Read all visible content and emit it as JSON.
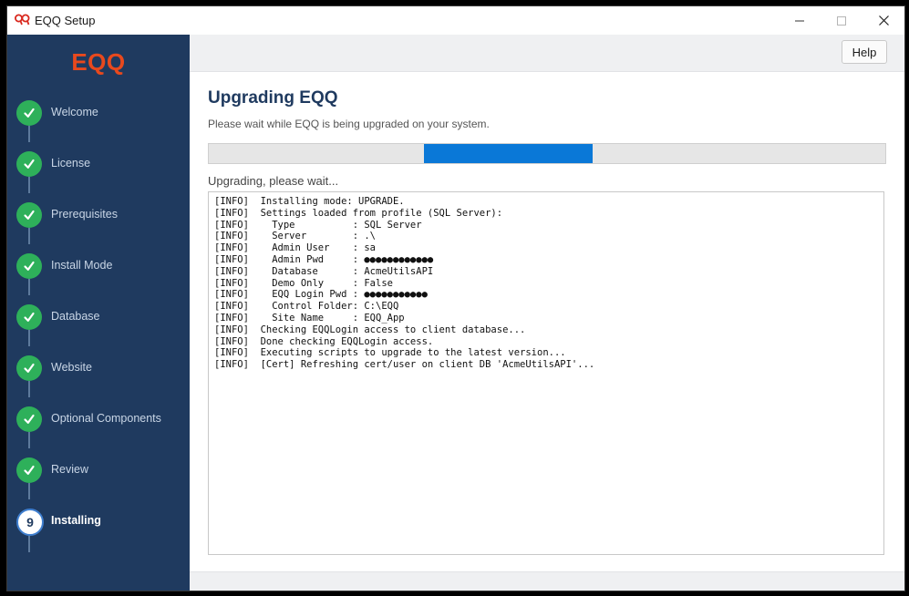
{
  "window": {
    "title": "EQQ Setup",
    "icon": "eqq-app-icon"
  },
  "sidebar": {
    "logo": "EQQ",
    "steps": [
      {
        "label": "Welcome",
        "state": "done"
      },
      {
        "label": "License",
        "state": "done"
      },
      {
        "label": "Prerequisites",
        "state": "done"
      },
      {
        "label": "Install Mode",
        "state": "done"
      },
      {
        "label": "Database",
        "state": "done"
      },
      {
        "label": "Website",
        "state": "done"
      },
      {
        "label": "Optional Components",
        "state": "done"
      },
      {
        "label": "Review",
        "state": "done"
      },
      {
        "label": "Installing",
        "state": "current",
        "number": "9"
      }
    ]
  },
  "toolbar": {
    "help_label": "Help"
  },
  "main": {
    "title": "Upgrading EQQ",
    "subtitle": "Please wait while EQQ is being upgraded on your system.",
    "progress": {
      "style": "indeterminate-marquee",
      "segment_start": 0.318,
      "segment_end": 0.568
    },
    "status": "Upgrading, please wait...",
    "log_lines": [
      "[INFO]  Installing mode: UPGRADE.",
      "[INFO]  Settings loaded from profile (SQL Server):",
      "[INFO]    Type          : SQL Server",
      "[INFO]    Server        : .\\",
      "[INFO]    Admin User    : sa",
      "[INFO]    Admin Pwd     : ●●●●●●●●●●●●",
      "[INFO]    Database      : AcmeUtilsAPI",
      "[INFO]    Demo Only     : False",
      "[INFO]    EQQ Login Pwd : ●●●●●●●●●●●",
      "[INFO]    Control Folder: C:\\EQQ",
      "[INFO]    Site Name     : EQQ_App",
      "[INFO]  Checking EQQLogin access to client database...",
      "[INFO]  Done checking EQQLogin access.",
      "[INFO]  Executing scripts to upgrade to the latest version...",
      "[INFO]  [Cert] Refreshing cert/user on client DB 'AcmeUtilsAPI'..."
    ]
  },
  "colors": {
    "sidebar_bg": "#1f3a5f",
    "logo": "#e8491d",
    "step_done": "#2eb05a",
    "progress_fill": "#0a78d7",
    "title": "#1f3a5f"
  }
}
